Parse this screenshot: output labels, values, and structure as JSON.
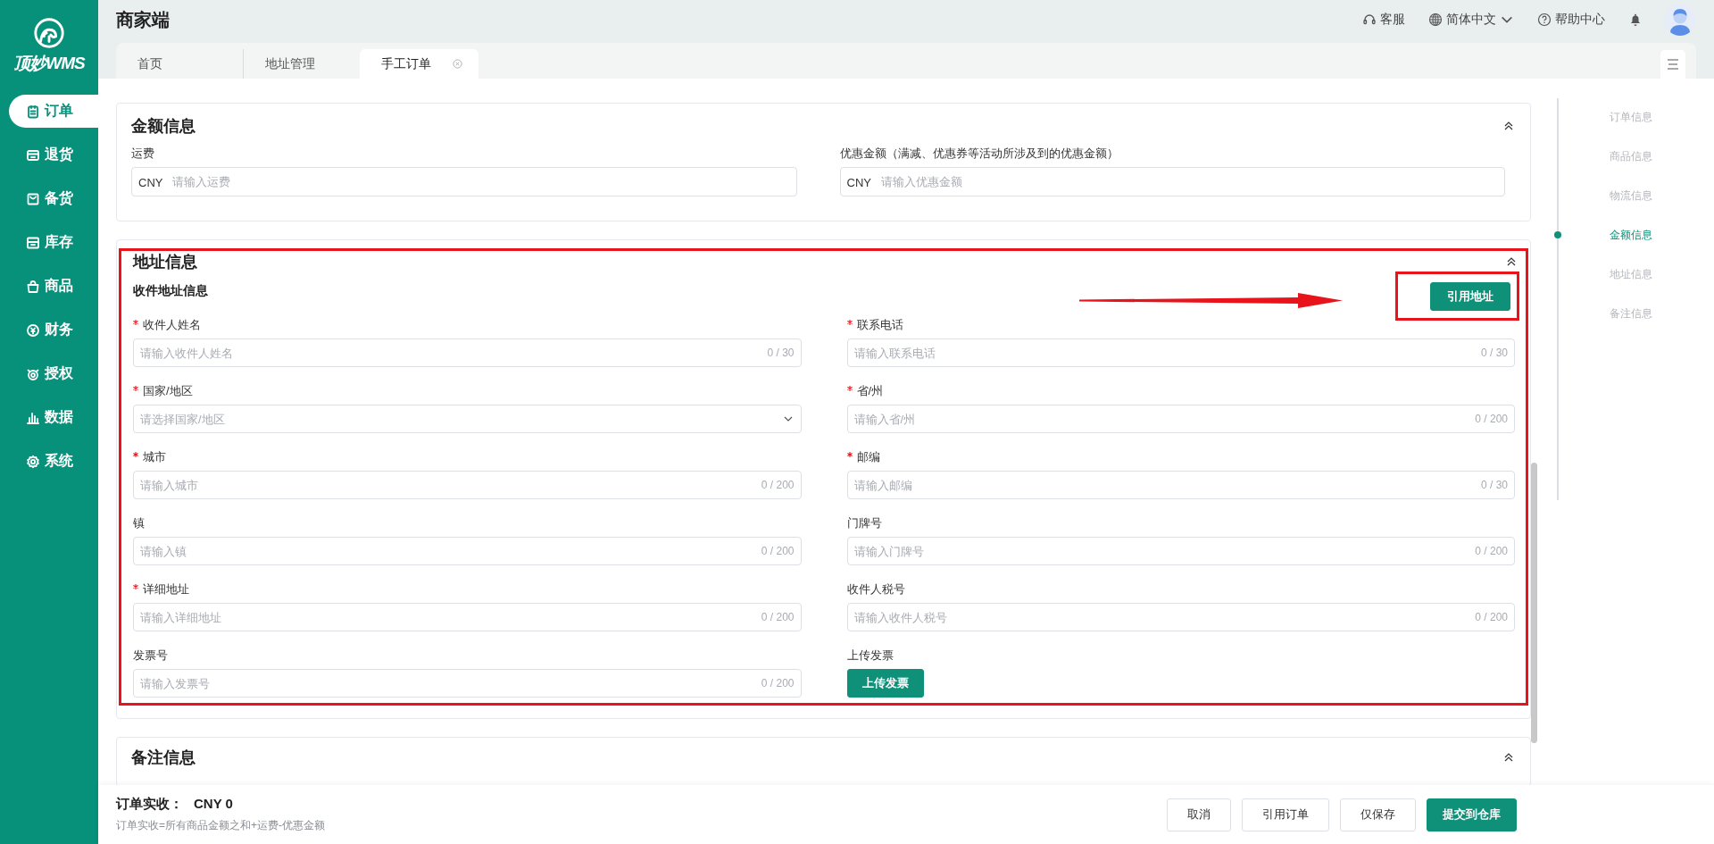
{
  "sidebar": {
    "logo_text": "顶妙WMS",
    "items": [
      {
        "label": "订单",
        "selected": true
      },
      {
        "label": "退货",
        "selected": false
      },
      {
        "label": "备货",
        "selected": false
      },
      {
        "label": "库存",
        "selected": false
      },
      {
        "label": "商品",
        "selected": false
      },
      {
        "label": "财务",
        "selected": false
      },
      {
        "label": "授权",
        "selected": false
      },
      {
        "label": "数据",
        "selected": false
      },
      {
        "label": "系统",
        "selected": false
      }
    ]
  },
  "header": {
    "title": "商家端",
    "links": [
      {
        "label": "客服",
        "dropdown": false
      },
      {
        "label": "简体中文",
        "dropdown": true
      },
      {
        "label": "帮助中心",
        "dropdown": false
      }
    ]
  },
  "tabs": [
    {
      "label": "首页",
      "selected": false,
      "closable": false
    },
    {
      "label": "地址管理",
      "selected": false,
      "closable": false
    },
    {
      "label": "手工订单",
      "selected": true,
      "closable": true
    }
  ],
  "sections": [
    {
      "title": "金额信息",
      "highlighted": false,
      "fields": [
        {
          "kind": "money",
          "label": "运费",
          "required": false,
          "prefix": "CNY",
          "placeholder": "请输入运费"
        },
        {
          "kind": "money",
          "label": "优惠金额（满减、优惠券等活动所涉及到的优惠金额）",
          "required": false,
          "prefix": "CNY",
          "placeholder": "请输入优惠金额"
        }
      ]
    },
    {
      "title": "地址信息",
      "highlighted": true,
      "subtitle": "收件地址信息",
      "action": {
        "label": "引用地址",
        "highlighted": true,
        "pointer_arrow": true
      },
      "fields": [
        {
          "kind": "text",
          "label": "收件人姓名",
          "required": true,
          "placeholder": "请输入收件人姓名",
          "counter": "0 / 30"
        },
        {
          "kind": "text",
          "label": "联系电话",
          "required": true,
          "placeholder": "请输入联系电话",
          "counter": "0 / 30"
        },
        {
          "kind": "select",
          "label": "国家/地区",
          "required": true,
          "placeholder": "请选择国家/地区"
        },
        {
          "kind": "text",
          "label": "省/州",
          "required": true,
          "placeholder": "请输入省/州",
          "counter": "0 / 200"
        },
        {
          "kind": "text",
          "label": "城市",
          "required": true,
          "placeholder": "请输入城市",
          "counter": "0 / 200"
        },
        {
          "kind": "text",
          "label": "邮编",
          "required": true,
          "placeholder": "请输入邮编",
          "counter": "0 / 30"
        },
        {
          "kind": "text",
          "label": "镇",
          "required": false,
          "placeholder": "请输入镇",
          "counter": "0 / 200"
        },
        {
          "kind": "text",
          "label": "门牌号",
          "required": false,
          "placeholder": "请输入门牌号",
          "counter": "0 / 200"
        },
        {
          "kind": "text",
          "label": "详细地址",
          "required": true,
          "placeholder": "请输入详细地址",
          "counter": "0 / 200"
        },
        {
          "kind": "text",
          "label": "收件人税号",
          "required": false,
          "placeholder": "请输入收件人税号",
          "counter": "0 / 200"
        },
        {
          "kind": "text",
          "label": "发票号",
          "required": false,
          "placeholder": "请输入发票号",
          "counter": "0 / 200"
        },
        {
          "kind": "upload",
          "label": "上传发票",
          "required": false,
          "button": "上传发票"
        }
      ]
    },
    {
      "title": "备注信息",
      "highlighted": false
    }
  ],
  "anchor_nav": [
    {
      "label": "订单信息",
      "selected": false
    },
    {
      "label": "商品信息",
      "selected": false
    },
    {
      "label": "物流信息",
      "selected": false
    },
    {
      "label": "金额信息",
      "selected": true
    },
    {
      "label": "地址信息",
      "selected": false
    },
    {
      "label": "备注信息",
      "selected": false
    }
  ],
  "footer": {
    "total_label": "订单实收：",
    "total_value": "CNY 0",
    "note": "订单实收=所有商品金额之和+运费-优惠金额",
    "buttons": [
      {
        "label": "取消",
        "kind": "default"
      },
      {
        "label": "引用订单",
        "kind": "default"
      },
      {
        "label": "仅保存",
        "kind": "default"
      },
      {
        "label": "提交到仓库",
        "kind": "primary"
      }
    ]
  }
}
